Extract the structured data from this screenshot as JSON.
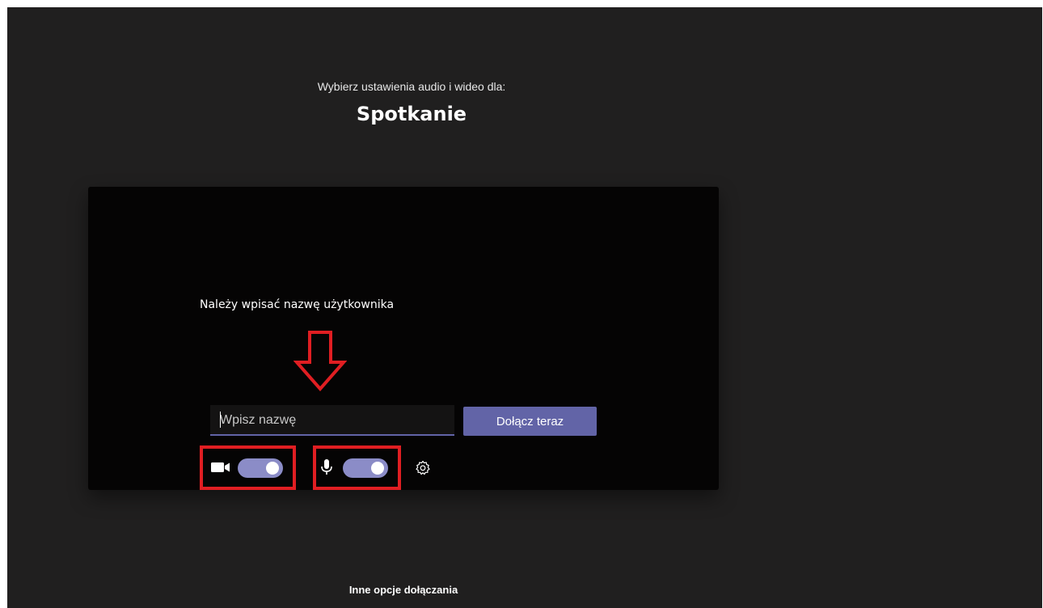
{
  "header": {
    "subtitle": "Wybierz ustawienia audio i wideo dla:",
    "title": "Spotkanie"
  },
  "preview": {
    "instruction": "Należy wpisać nazwę użytkownika",
    "name_input": {
      "value": "",
      "placeholder": "Wpisz nazwę"
    },
    "join_button_label": "Dołącz teraz",
    "camera": {
      "icon": "video-camera-icon",
      "enabled": true
    },
    "microphone": {
      "icon": "microphone-icon",
      "enabled": true
    },
    "settings_icon": "gear-icon"
  },
  "footer": {
    "other_options_label": "Inne opcje dołączania"
  },
  "colors": {
    "background": "#201f1f",
    "preview_background": "#050404",
    "accent": "#6264a7",
    "toggle_on": "#8b8cc7",
    "annotation": "#e01e22"
  }
}
